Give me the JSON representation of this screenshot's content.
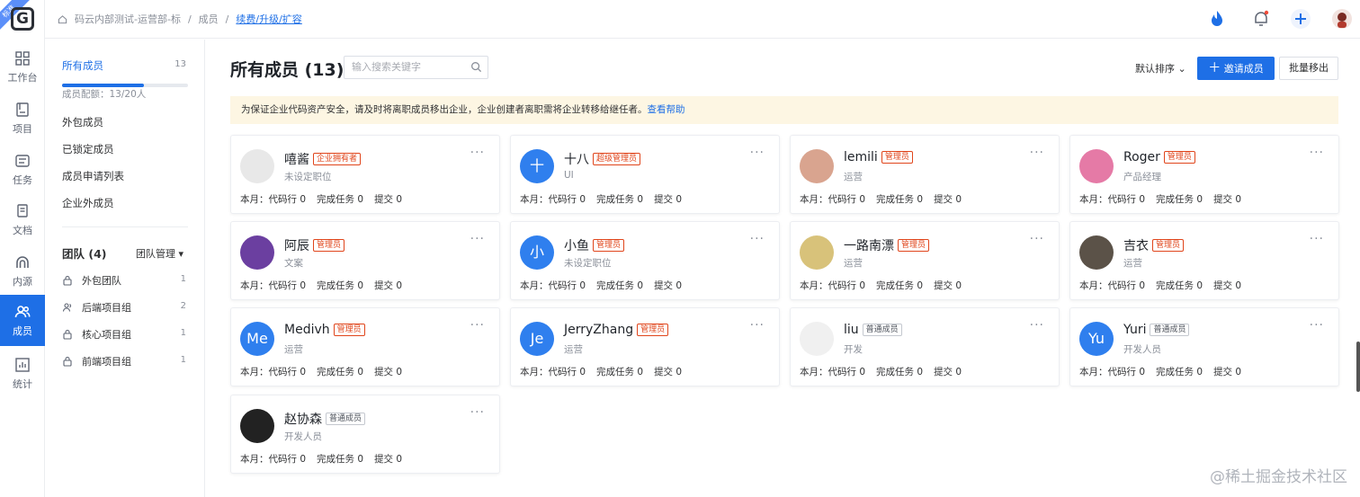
{
  "rail": {
    "ribbon": "标准",
    "logo": "G",
    "items": [
      {
        "label": "工作台",
        "icon": "grid-icon"
      },
      {
        "label": "项目",
        "icon": "book-icon"
      },
      {
        "label": "任务",
        "icon": "task-icon"
      },
      {
        "label": "文档",
        "icon": "doc-icon"
      },
      {
        "label": "内源",
        "icon": "inner-source-icon"
      },
      {
        "label": "成员",
        "icon": "members-icon",
        "active": true
      },
      {
        "label": "统计",
        "icon": "chart-icon"
      }
    ]
  },
  "topbar": {
    "breadcrumb": [
      "码云内部测试-运营部-标",
      "/",
      "成员",
      "/"
    ],
    "upgrade_link": "续费/升级/扩容"
  },
  "side": {
    "items": [
      {
        "label": "所有成员",
        "count": "13"
      },
      {
        "label": "外包成员"
      },
      {
        "label": "已锁定成员"
      },
      {
        "label": "成员申请列表"
      },
      {
        "label": "企业外成员"
      }
    ],
    "quota_text": "成员配额：13/20人",
    "quota_fraction": 0.65,
    "team_title": "团队 (4)",
    "team_manage": "团队管理",
    "teams": [
      {
        "label": "外包团队",
        "count": "1"
      },
      {
        "label": "后端项目组",
        "count": "2"
      },
      {
        "label": "核心项目组",
        "count": "1"
      },
      {
        "label": "前端项目组",
        "count": "1"
      }
    ]
  },
  "main": {
    "title": "所有成员 (13)",
    "search_placeholder": "输入搜索关键字",
    "sort": "默认排序",
    "invite": "邀请成员",
    "batch_remove": "批量移出",
    "notice": "为保证企业代码资产安全，请及时将离职成员移出企业，企业创建者离职需将企业转移给继任者。",
    "notice_link": "查看帮助",
    "stats_labels": [
      "本月：代码行 0",
      "完成任务 0",
      "提交 0"
    ],
    "members": [
      {
        "name": "嘻酱",
        "role": "企业拥有者",
        "role_type": "owner",
        "position": "未设定职位",
        "avatar_color": "#e8e8e8",
        "avatar_text": ""
      },
      {
        "name": "十八",
        "role": "超级管理员",
        "role_type": "super",
        "position": "UI",
        "avatar_color": "#2f7fee",
        "avatar_text": "十"
      },
      {
        "name": "lemili",
        "role": "管理员",
        "role_type": "admin",
        "position": "运营",
        "avatar_color": "#d9a48f",
        "avatar_text": ""
      },
      {
        "name": "Roger",
        "role": "管理员",
        "role_type": "admin",
        "position": "产品经理",
        "avatar_color": "#e57aa6",
        "avatar_text": ""
      },
      {
        "name": "阿辰",
        "role": "管理员",
        "role_type": "admin",
        "position": "文案",
        "avatar_color": "#6b3fa0",
        "avatar_text": ""
      },
      {
        "name": "小鱼",
        "role": "管理员",
        "role_type": "admin",
        "position": "未设定职位",
        "avatar_color": "#2f7fee",
        "avatar_text": "小"
      },
      {
        "name": "一路南漂",
        "role": "管理员",
        "role_type": "admin",
        "position": "运营",
        "avatar_color": "#d8c27a",
        "avatar_text": ""
      },
      {
        "name": "吉衣",
        "role": "管理员",
        "role_type": "admin",
        "position": "运营",
        "avatar_color": "#5b5248",
        "avatar_text": ""
      },
      {
        "name": "Medivh",
        "role": "管理员",
        "role_type": "admin",
        "position": "运营",
        "avatar_color": "#2f7fee",
        "avatar_text": "Me"
      },
      {
        "name": "JerryZhang",
        "role": "管理员",
        "role_type": "admin",
        "position": "运营",
        "avatar_color": "#2f7fee",
        "avatar_text": "Je"
      },
      {
        "name": "liu",
        "role": "普通成员",
        "role_type": "normal",
        "position": "开发",
        "avatar_color": "#f0f0f0",
        "avatar_text": ""
      },
      {
        "name": "Yuri",
        "role": "普通成员",
        "role_type": "normal",
        "position": "开发人员",
        "avatar_color": "#2f7fee",
        "avatar_text": "Yu"
      },
      {
        "name": "赵协森",
        "role": "普通成员",
        "role_type": "normal",
        "position": "开发人员",
        "avatar_color": "#222222",
        "avatar_text": ""
      }
    ]
  },
  "watermark": "@稀土掘金技术社区"
}
